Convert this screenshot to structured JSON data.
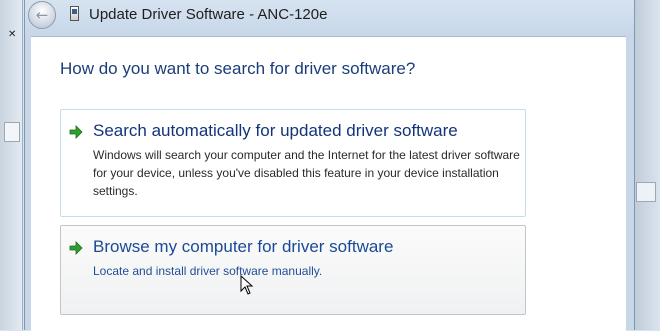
{
  "window": {
    "title": "Update Driver Software - ANC-120e"
  },
  "heading": "How do you want to search for driver software?",
  "options": [
    {
      "title": "Search automatically for updated driver software",
      "description": "Windows will search your computer and the Internet for the latest driver software for your device, unless you've disabled this feature in your device installation settings.",
      "icon": "green-arrow-icon"
    },
    {
      "title": "Browse my computer for driver software",
      "description": "Locate and install driver software manually.",
      "icon": "green-arrow-icon"
    }
  ],
  "icons": {
    "back": "back-arrow-icon",
    "app": "device-icon",
    "cursor": "mouse-pointer-icon"
  },
  "colors": {
    "heading": "#1c3d7a",
    "option_title": "#12357a",
    "arrow": "#2f9e2f"
  }
}
